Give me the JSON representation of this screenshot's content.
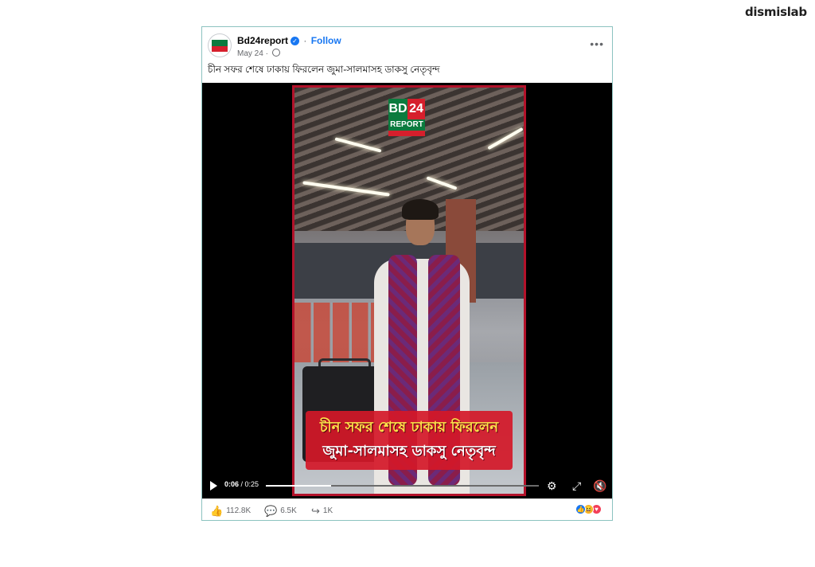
{
  "watermark": {
    "brand": "dismislab"
  },
  "post": {
    "page_name": "Bd24report",
    "follow_label": "Follow",
    "date": "May 24",
    "caption": "চীন সফর শেষে ঢাকায় ফিরলেন জুমা-সালমাসহ ডাকসু নেতৃবৃন্দ",
    "more_label": "•••"
  },
  "video": {
    "logo": {
      "line1a": "BD",
      "line1b": "24",
      "line2": "REPORT"
    },
    "overlay_line1": "চীন সফর শেষে ঢাকায় ফিরলেন",
    "overlay_line2": "জুমা-সালমাসহ ডাকসু নেতৃবৃন্দ",
    "current_time": "0:06",
    "duration": "/ 0:25",
    "progress": 0.24,
    "icons": {
      "play": "play-icon",
      "settings": "gear-icon",
      "fullscreen": "expand-icon",
      "mute": "speaker-muted-icon"
    }
  },
  "footer": {
    "likes": "112.8K",
    "comments": "6.5K",
    "shares": "1K",
    "reactions": [
      "like",
      "haha",
      "love"
    ]
  },
  "colors": {
    "accent": "#1877f2",
    "banner": "#d41828",
    "border": "#8cc3c0"
  }
}
